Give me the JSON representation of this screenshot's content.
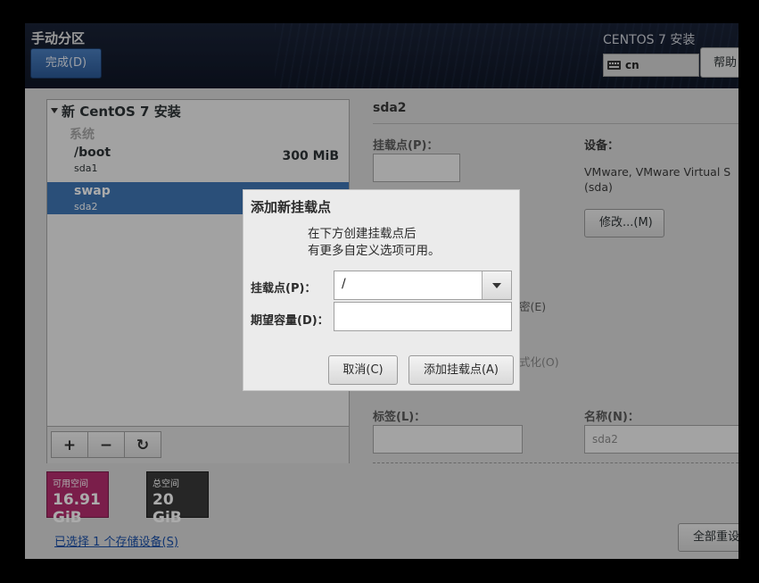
{
  "header": {
    "title": "手动分区",
    "done_label": "完成(D)",
    "product": "CENTOS 7 安装",
    "keyboard_layout": "cn",
    "help_label": "帮助"
  },
  "tree": {
    "heading": "新 CentOS 7 安装",
    "group": "系统",
    "partitions": [
      {
        "mount": "/boot",
        "device": "sda1",
        "size": "300 MiB"
      },
      {
        "mount": "swap",
        "device": "sda2",
        "size": ""
      }
    ],
    "toolbar": {
      "add": "+",
      "remove": "−",
      "refresh": "↻"
    }
  },
  "space": {
    "available_label": "可用空间",
    "available_value": "16.91 GiB",
    "total_label": "总空间",
    "total_value": "20 GiB"
  },
  "storage_link": "已选择 1 个存储设备(S)",
  "details": {
    "title": "sda2",
    "mount_label": "挂载点(P)：",
    "device_label": "设备：",
    "device_value": "VMware, VMware Virtual S (sda)",
    "modify_label": "修改...(M)",
    "encrypt_partial": "密(E)",
    "format_partial": "式化(O)",
    "tag_label": "标签(L)：",
    "name_label": "名称(N)：",
    "name_value": "sda2",
    "reset_label": "全部重设"
  },
  "dialog": {
    "title": "添加新挂载点",
    "message_line1": "在下方创建挂载点后",
    "message_line2": "有更多自定义选项可用。",
    "mount_label": "挂载点(P)：",
    "mount_value": "/",
    "capacity_label": "期望容量(D)：",
    "capacity_value": "",
    "cancel_label": "取消(C)",
    "add_label": "添加挂载点(A)"
  }
}
